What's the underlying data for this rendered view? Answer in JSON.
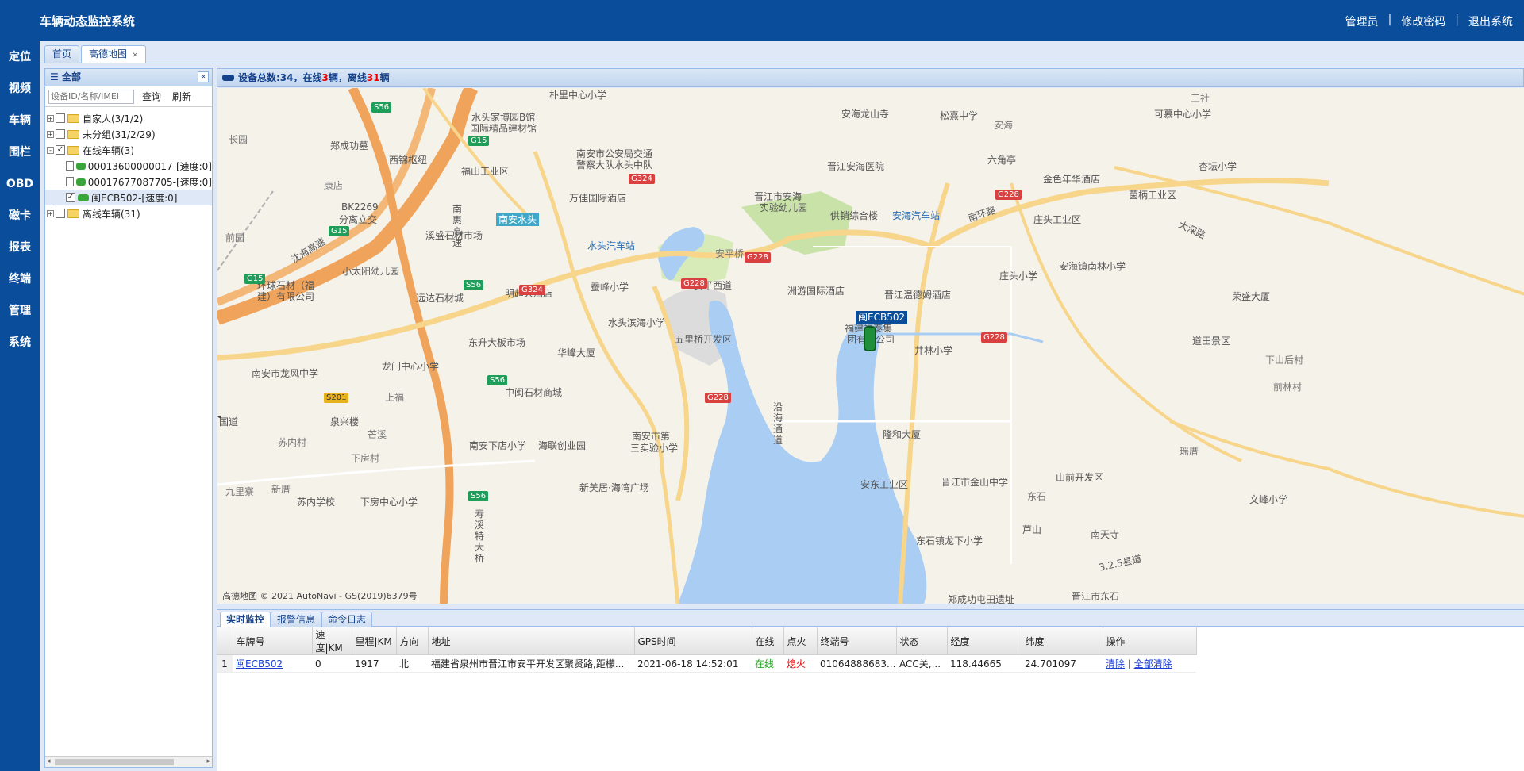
{
  "header": {
    "title": "车辆动态监控系统",
    "links": [
      "管理员",
      "修改密码",
      "退出系统"
    ],
    "separator": "|"
  },
  "nav": [
    "定位",
    "视频",
    "车辆",
    "围栏",
    "OBD",
    "磁卡",
    "报表",
    "终端",
    "管理",
    "系统"
  ],
  "tabs": [
    {
      "label": "首页"
    },
    {
      "label": "高德地图",
      "close": "×"
    }
  ],
  "leftpanel": {
    "title": "全部",
    "collapse": "«",
    "search_placeholder": "设备ID/名称/IMEI",
    "query": "查询",
    "refresh": "刷新",
    "tree": [
      {
        "label": "自家人(3/1/2)",
        "expander": "+",
        "checked": ""
      },
      {
        "label": "未分组(31/2/29)",
        "expander": "+",
        "checked": ""
      },
      {
        "label": "在线车辆(3)",
        "expander": "-",
        "checked": "✓"
      },
      {
        "label": "00013600000017-[速度:0]",
        "checked": ""
      },
      {
        "label": "00017677087705-[速度:0]",
        "checked": ""
      },
      {
        "label": "闽ECB502-[速度:0]",
        "checked": "✓"
      },
      {
        "label": "离线车辆(31)",
        "expander": "+",
        "checked": ""
      }
    ]
  },
  "status": {
    "prefix": "设备总数:34，在线",
    "online": "3",
    "mid": "辆，离线",
    "offline": "31",
    "suffix": "辆"
  },
  "map": {
    "vehicle_label": "闽ECB502",
    "badge": "南安水头",
    "copyright": "© 2021 AutoNavi - GS(2019)6379号",
    "logo": "高德地图",
    "pois": [
      "朴里中心小学",
      "水头家博园B馆",
      "国际精品建材馆",
      "福山工业区",
      "南安市公安局交通",
      "警察大队水头中队",
      "万佳国际酒店",
      "西锦枢纽",
      "郑成功墓",
      "长园",
      "康店",
      "BK2269",
      "分离立交",
      "前园",
      "沈海高速",
      "小太阳幼儿园",
      "环球石材（福",
      "建）有限公司",
      "溪盛石材市场",
      "水头汽车站",
      "明超大酒店",
      "远达石材城",
      "东升大板市场",
      "蚕峰小学",
      "水头滨海小学",
      "华峰大厦",
      "南安市龙风中学",
      "龙门中心小学",
      "上福",
      "中闽石材商城",
      "泉兴楼",
      "芒溪",
      "苏内村",
      "下房村",
      "南安下店小学",
      "海联创业园",
      "南安市第",
      "三实验小学",
      "新美居·海湾广场",
      "苏内学校",
      "下房中心小学",
      "九里寮",
      "新厝",
      "晋江市安海",
      "实验幼儿园",
      "安平桥",
      "五里桥开发区",
      "安平西道",
      "洲游国际酒店",
      "晋江温德姆酒店",
      "安海龙山寺",
      "晋江安海医院",
      "供销综合楼",
      "安海汽车站",
      "松熹中学",
      "安海",
      "六角亭",
      "金色年华酒店",
      "庄头工业区",
      "南环路",
      "庄头小学",
      "安海镇南林小学",
      "可慕中心小学",
      "杏坛小学",
      "菌柄工业区",
      "大深路",
      "荣盛大厦",
      "道田景区",
      "福建福泰集",
      "团有限公司",
      "井林小学",
      "隆和大厦",
      "安东工业区",
      "晋江市金山中学",
      "山前开发区",
      "东石镇龙下小学",
      "芦山",
      "南天寺",
      "文峰小学",
      "郑成功屯田遗址",
      "晋江市东石",
      "3.2.5县道",
      "沿海通道",
      "国道",
      "寿溪特大桥",
      "南惠高速",
      "东石",
      "三社",
      "下山后村",
      "前林村",
      "瑶厝"
    ],
    "shields": [
      "S56",
      "G15",
      "G324",
      "G15",
      "G15",
      "S56",
      "G324",
      "S56",
      "S201",
      "S56",
      "G228",
      "G228",
      "G228",
      "G228",
      "G228"
    ]
  },
  "bottom": {
    "tabs": [
      "实时监控",
      "报警信息",
      "命令日志"
    ],
    "columns": [
      "车牌号",
      "速度|KM",
      "里程|KM",
      "方向",
      "地址",
      "GPS时间",
      "在线",
      "点火",
      "终端号",
      "状态",
      "经度",
      "纬度",
      "操作"
    ],
    "rows": [
      {
        "index": "1",
        "plate": "闽ECB502",
        "speed": "0",
        "mileage": "1917",
        "direction": "北",
        "address": "福建省泉州市晋江市安平开发区聚贤路,距檬...",
        "gps_time": "2021-06-18 14:52:01",
        "online": "在线",
        "fire": "熄火",
        "terminal": "01064888683...",
        "state": "ACC关,...",
        "lng": "118.44665",
        "lat": "24.701097",
        "op_clear": "清除",
        "op_sep": "|",
        "op_clear_all": "全部清除"
      }
    ]
  },
  "colors": {
    "header": "#0a4e9b",
    "accent": "#15428b",
    "online": "#22aa22",
    "danger": "#e00000"
  }
}
